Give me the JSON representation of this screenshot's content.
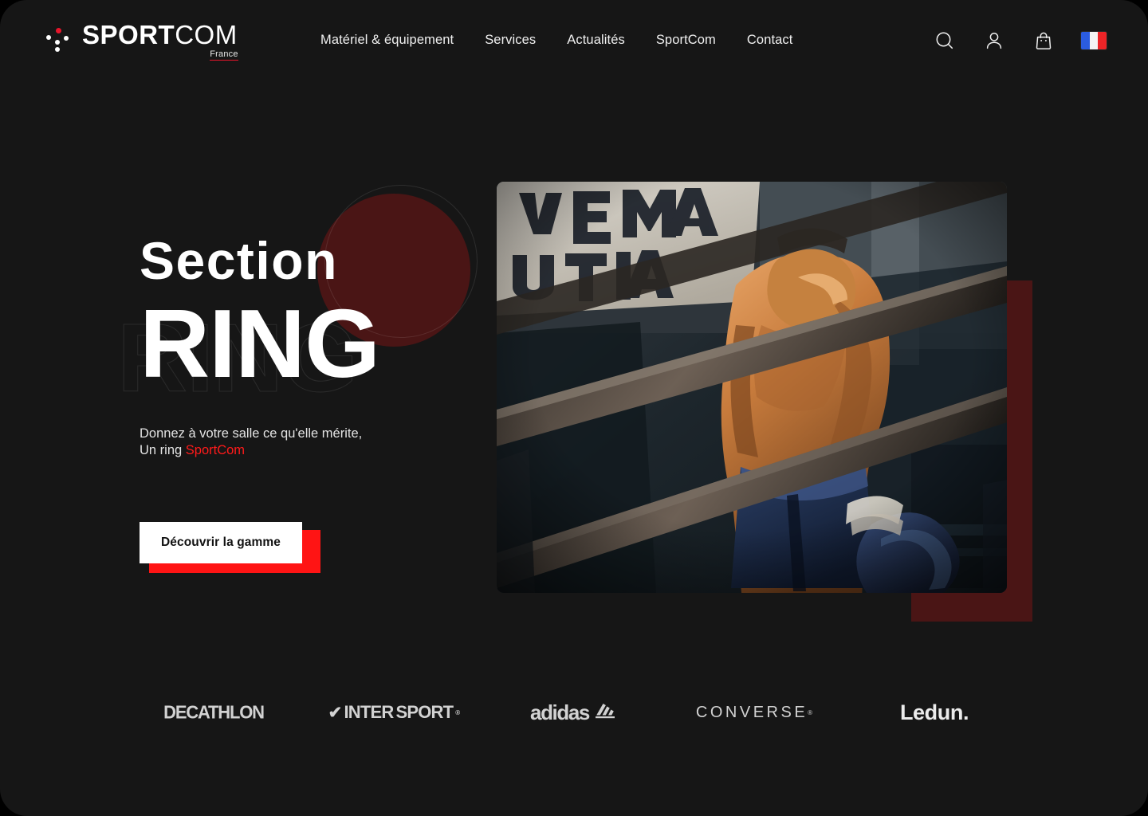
{
  "theme": {
    "background": "#161616",
    "accent_red": "#ff1414",
    "brand_red": "#e8152b",
    "deep_red": "#4a1515",
    "text_light": "#f0f0f0"
  },
  "header": {
    "logo": {
      "word_solid": "SPORT",
      "word_outline": "COM",
      "sub": "France",
      "mark_icon": "dots-cluster-icon"
    },
    "nav": [
      {
        "label": "Matériel & équipement"
      },
      {
        "label": "Services"
      },
      {
        "label": "Actualités"
      },
      {
        "label": "SportCom"
      },
      {
        "label": "Contact"
      }
    ],
    "icons": [
      {
        "name": "search-icon"
      },
      {
        "name": "user-account-icon"
      },
      {
        "name": "shopping-bag-icon"
      },
      {
        "name": "france-flag-icon"
      }
    ]
  },
  "hero": {
    "title_line1": "Section",
    "title_line2": "RING",
    "title_ghost": "RING",
    "subtitle_line1": "Donnez à votre salle ce qu'elle mérite,",
    "subtitle_line2_prefix": "Un ring ",
    "subtitle_line2_brand": "SportCom",
    "cta_label": "Découvrir la gamme",
    "image_alt": "boxer-in-ring-photo"
  },
  "brands": [
    {
      "name": "decathlon",
      "label": "DECATHLON"
    },
    {
      "name": "intersport",
      "label": "INTERSPORT",
      "check": "✔",
      "bold_part": "SPORT",
      "light_part": "INTER",
      "tm": "®"
    },
    {
      "name": "adidas",
      "label": "adidas"
    },
    {
      "name": "converse",
      "label": "CONVERSE",
      "tm": "®"
    },
    {
      "name": "ledun",
      "label": "Ledun."
    }
  ]
}
